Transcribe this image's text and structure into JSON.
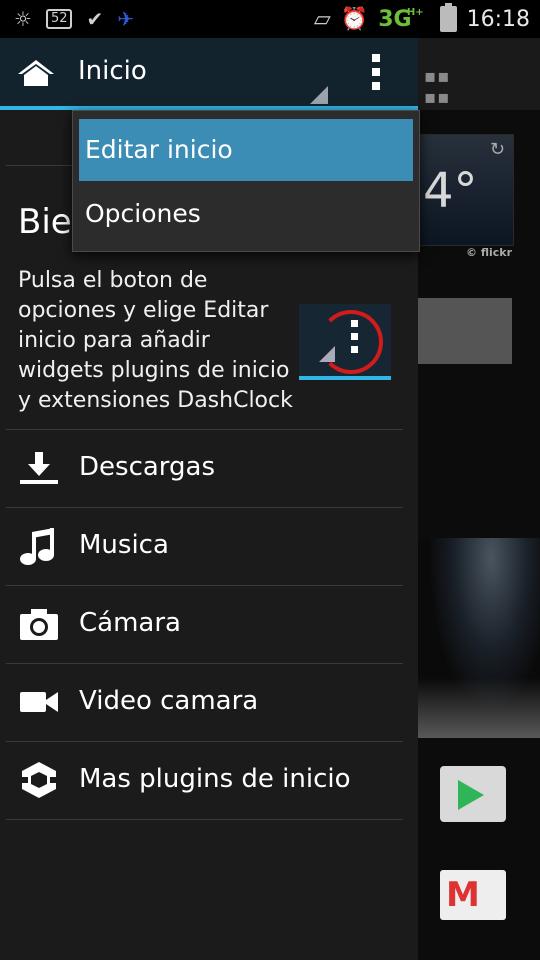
{
  "status_bar": {
    "icons_left": [
      "weather-icon",
      "badge-52-icon",
      "check-circle-icon",
      "bird-app-icon"
    ],
    "badge_text": "52",
    "network": "3G",
    "network_sup": "H+",
    "time": "16:18"
  },
  "app_bar": {
    "title": "Inicio"
  },
  "popup_menu": {
    "items": [
      {
        "label": "Editar inicio",
        "selected": true
      },
      {
        "label": "Opciones",
        "selected": false
      }
    ]
  },
  "welcome": {
    "title_partial": "Bie",
    "text": "Pulsa el boton de opciones y elige Editar inicio para añadir widgets plugins de inicio y extensiones DashClock"
  },
  "menu": {
    "items": [
      {
        "label": "Descargas",
        "icon": "download-icon"
      },
      {
        "label": "Musica",
        "icon": "music-note-icon"
      },
      {
        "label": "Cámara",
        "icon": "camera-icon"
      },
      {
        "label": "Video camara",
        "icon": "videocam-icon"
      },
      {
        "label": "Mas plugins de inicio",
        "icon": "plugin-hex-icon"
      }
    ]
  },
  "background": {
    "weather_temp": "4°",
    "flickr_label": "© flickr"
  },
  "colors": {
    "accent": "#33b5e5",
    "appbar_bg": "#12232e",
    "drawer_bg": "#1b1b1b",
    "popup_selected": "#3c8db5"
  }
}
